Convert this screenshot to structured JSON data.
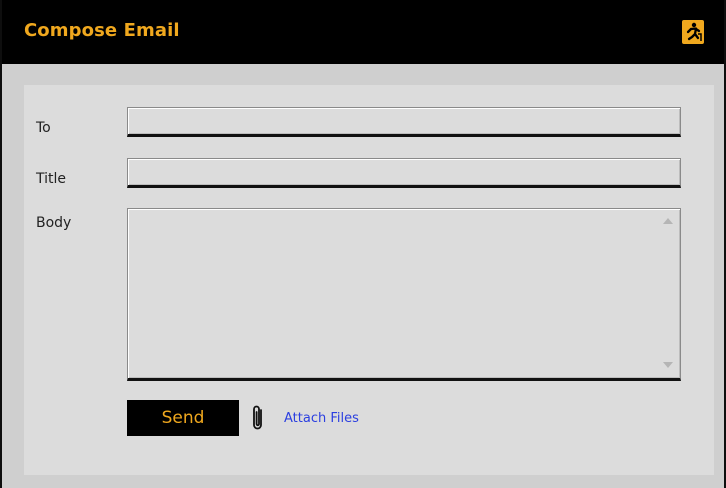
{
  "window": {
    "title": "Compose Email",
    "exit_icon": "exit-running-man-icon",
    "accent_color": "#f0a81e"
  },
  "form": {
    "to_label": "To",
    "to_value": "",
    "title_label": "Title",
    "title_value": "",
    "body_label": "Body",
    "body_value": ""
  },
  "actions": {
    "send_label": "Send",
    "attach_icon": "paperclip-icon",
    "attach_label": "Attach Files",
    "attach_color": "#2b3fe0"
  }
}
